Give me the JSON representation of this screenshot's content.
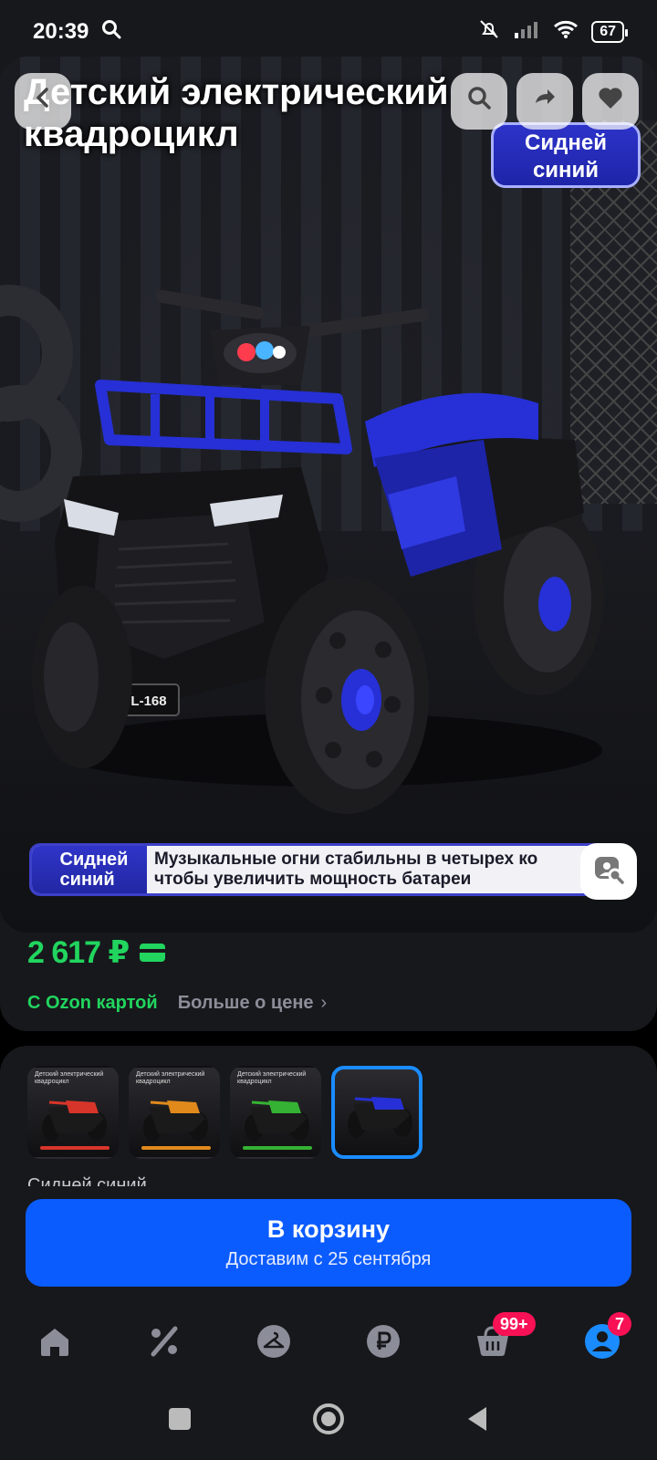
{
  "status_bar": {
    "time": "20:39",
    "battery": "67"
  },
  "hero": {
    "title_line1": "Детский электрический",
    "title_line2": "квадроцикл",
    "color_tag_line1": "Сидней",
    "color_tag_line2": "синий",
    "caption_tag_line1": "Сидней",
    "caption_tag_line2": "синий",
    "caption_line1": "Музыкальные огни стабильны в четырех ко",
    "caption_line2": "чтобы увеличить мощность батареи",
    "plate_text": "L-168"
  },
  "price": {
    "value": "2 617 ₽",
    "ozon_card_label": "С Ozon картой",
    "more_label": "Больше о цене"
  },
  "variants": {
    "items": [
      {
        "title": "Детский электрический квадроцикл",
        "color": "#d8352a"
      },
      {
        "title": "Детский электрический квадроцикл",
        "color": "#e08a1c"
      },
      {
        "title": "Детский электрический квадроцикл",
        "color": "#35b233"
      },
      {
        "title": "",
        "color": "#2630d6",
        "selected": true
      }
    ],
    "selected_name": "Сидней синий"
  },
  "cart": {
    "label": "В корзину",
    "sub": "Доставим с 25 сентября"
  },
  "nav": {
    "items": [
      {
        "icon": "home-icon"
      },
      {
        "icon": "percent-icon"
      },
      {
        "icon": "hanger-icon"
      },
      {
        "icon": "ruble-icon"
      },
      {
        "icon": "cart-icon",
        "badge": "99+"
      },
      {
        "icon": "profile-icon",
        "badge": "7"
      }
    ]
  },
  "colors": {
    "accent": "#0b5cff",
    "price": "#21d55e",
    "badge": "#f91155",
    "background": "#17181c"
  }
}
